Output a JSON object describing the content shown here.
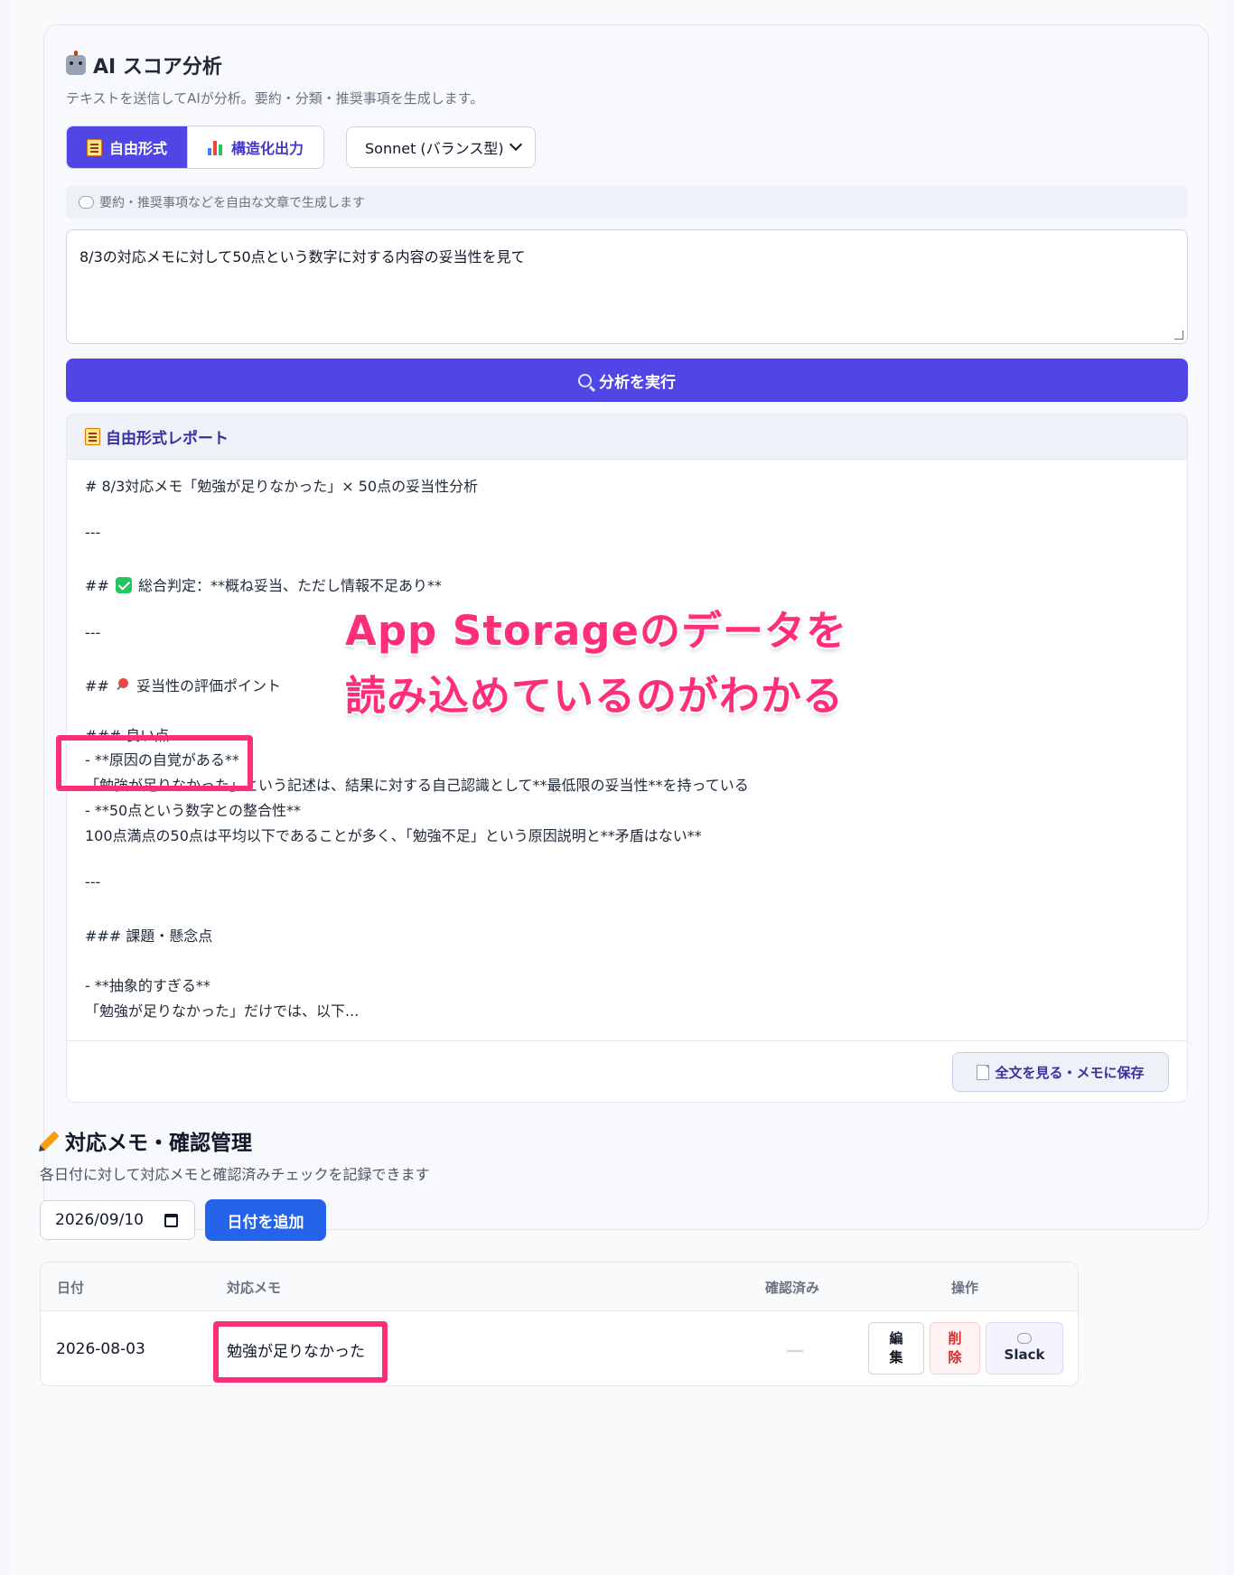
{
  "ai": {
    "title": "AI スコア分析",
    "subtitle": "テキストを送信してAIが分析。要約・分類・推奨事項を生成します。",
    "mode_free": "自由形式",
    "mode_structured": "構造化出力",
    "model_select": "Sonnet (バランス型)",
    "hint": "要約・推奨事項などを自由な文章で生成します",
    "prompt_value": "8/3の対応メモに対して50点という数字に対する内容の妥当性を見て",
    "run_label": "分析を実行",
    "report_title": "自由形式レポート",
    "report_lines": {
      "l1": "# 8/3対応メモ「勉強が足りなかった」× 50点の妥当性分析",
      "l2": "---",
      "l3a": "## ",
      "l3b": " 総合判定：**概ね妥当、ただし情報不足あり**",
      "l4": "---",
      "l5a": "## ",
      "l5b": " 妥当性の評価ポイント",
      "l6": "### 良い点",
      "l7": "- **原因の自覚がある**",
      "l8": "「勉強が足りなかった」という記述は、結果に対する自己認識として**最低限の妥当性**を持っている",
      "l9": "- **50点という数字との整合性**",
      "l10": "100点満点の50点は平均以下であることが多く、「勉強不足」という原因説明と**矛盾はない**",
      "l11": "---",
      "l12": "### 課題・懸念点",
      "l13": "- **抽象的すぎる**",
      "l14": "「勉強が足りなかった」だけでは、以下..."
    },
    "full_button": "全文を見る・メモに保存"
  },
  "annotation": {
    "line1": "App Storageのデータを",
    "line2": "読み込めているのがわかる"
  },
  "memo": {
    "title": "対応メモ・確認管理",
    "subtitle": "各日付に対して対応メモと確認済みチェックを記録できます",
    "date_value": "2026/09/10",
    "add_button": "日付を追加",
    "columns": {
      "date": "日付",
      "memo": "対応メモ",
      "checked": "確認済み",
      "actions": "操作"
    },
    "rows": [
      {
        "date": "2026-08-03",
        "memo": "勉強が足りなかった",
        "edit": "編\n集",
        "delete": "削\n除",
        "slack": "Slack"
      }
    ]
  },
  "colors": {
    "primary": "#4f46e5",
    "add_button": "#2563eb",
    "annotation": "#ff2e7a"
  },
  "icons": [
    "robot-icon",
    "memo-icon",
    "bar-chart-icon",
    "chevron-down-icon",
    "speech-bubble-icon",
    "search-icon",
    "check-icon",
    "pushpin-icon",
    "document-icon",
    "pencil-icon",
    "calendar-icon"
  ]
}
